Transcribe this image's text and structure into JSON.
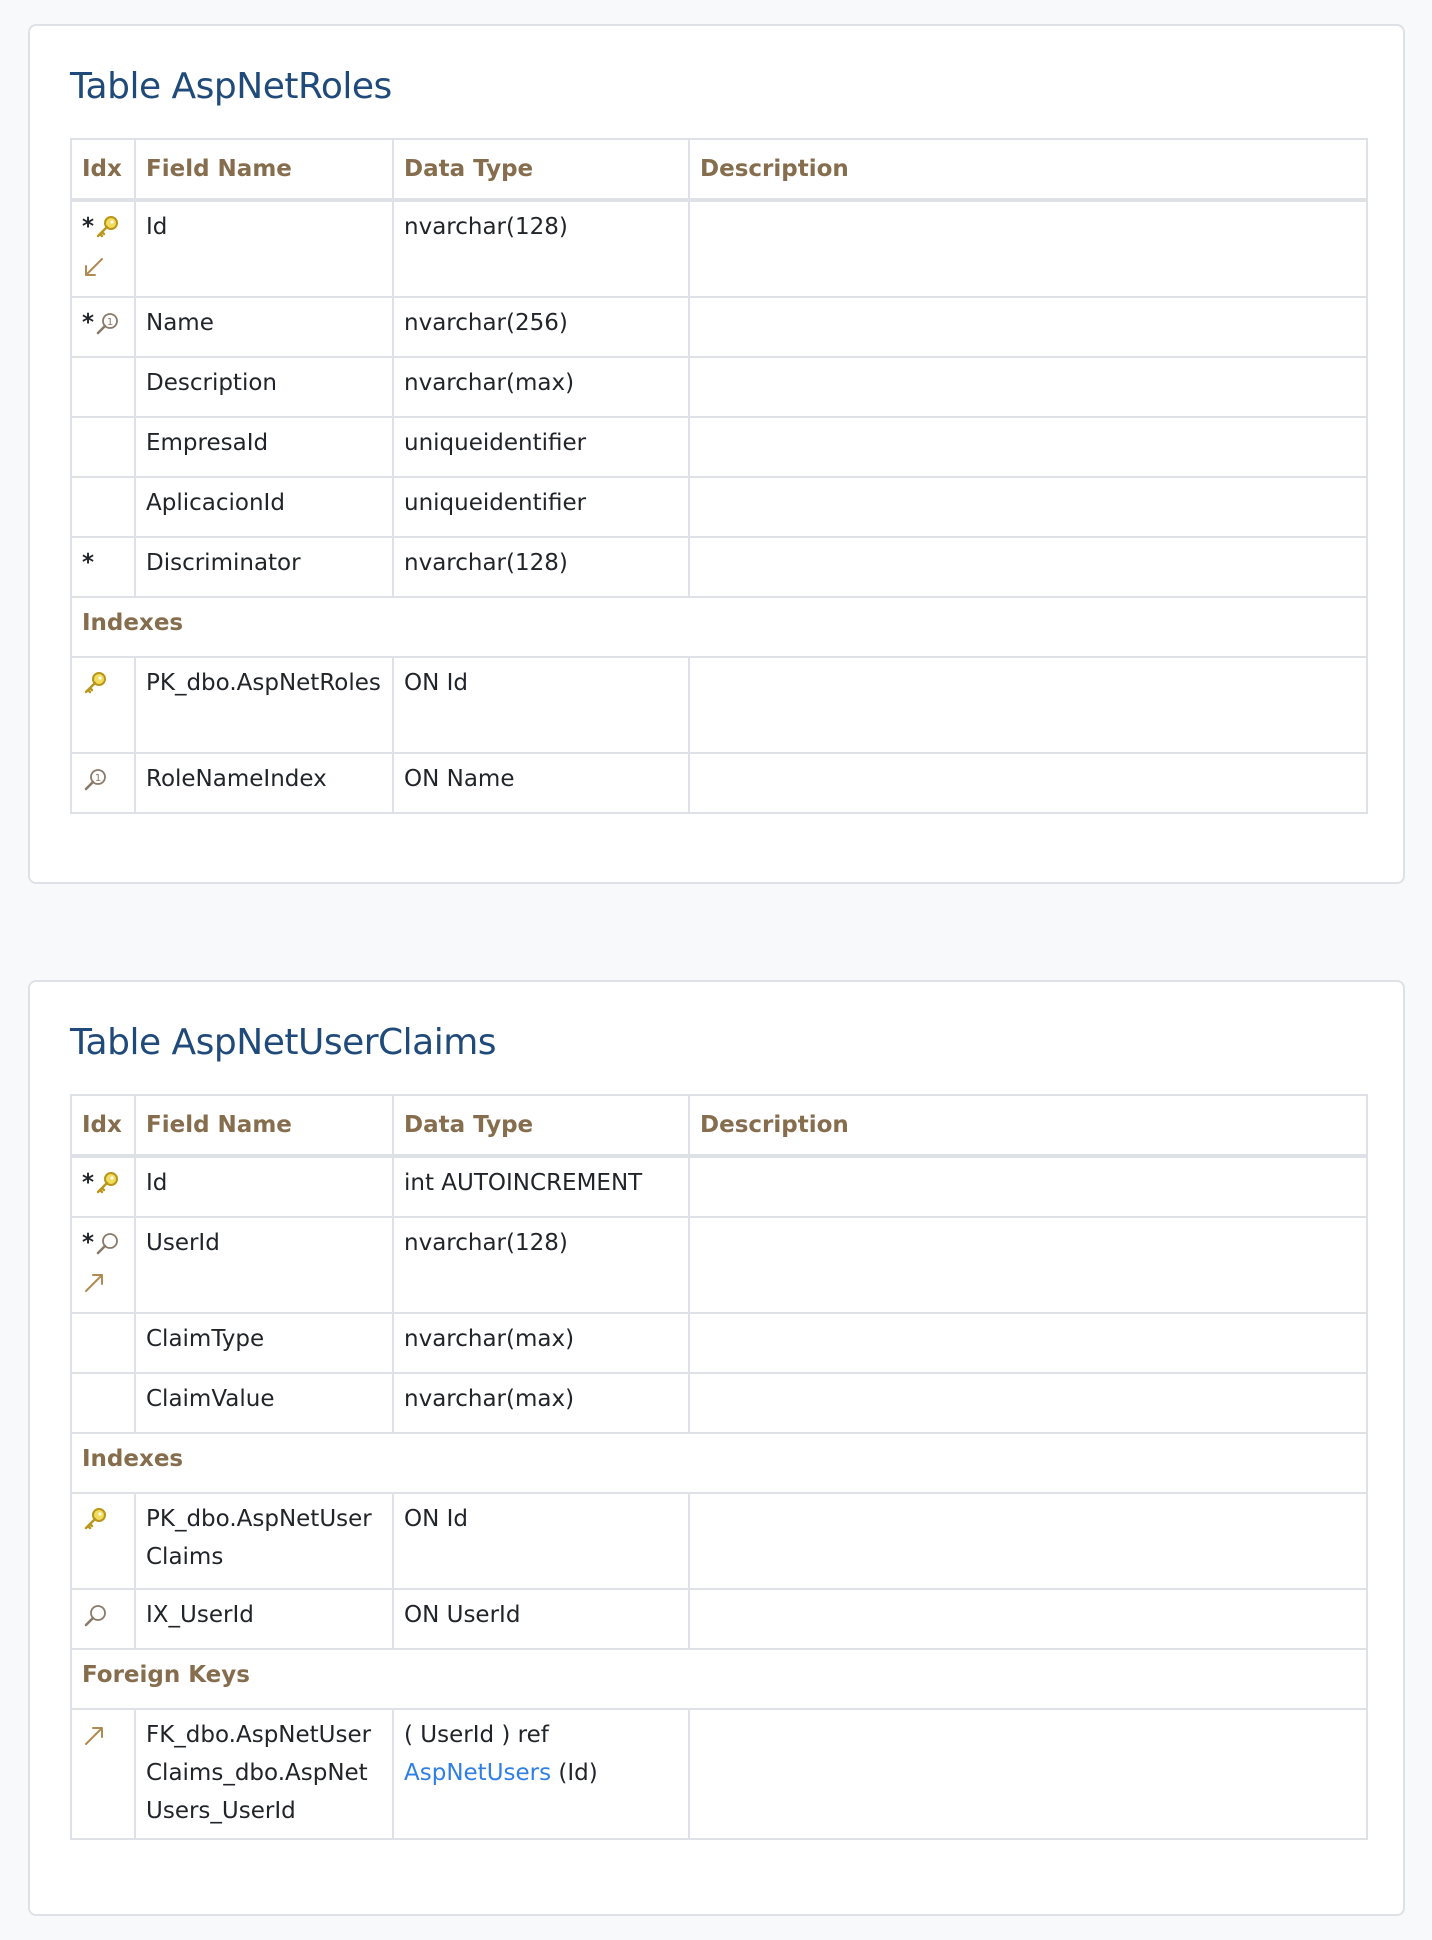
{
  "tables": [
    {
      "title": "Table AspNetRoles",
      "headers": {
        "idx": "Idx",
        "field": "Field Name",
        "type": "Data Type",
        "desc": "Description"
      },
      "columns": [
        {
          "star": "*",
          "icons": [
            "pk-key-icon",
            "fk-in-arrow-icon"
          ],
          "name": "Id",
          "type": "nvarchar(128)",
          "desc": ""
        },
        {
          "star": "*",
          "icons": [
            "unique-index-icon"
          ],
          "name": "Name",
          "type": "nvarchar(256)",
          "desc": ""
        },
        {
          "star": "",
          "icons": [],
          "name": "Description",
          "type": "nvarchar(max)",
          "desc": ""
        },
        {
          "star": "",
          "icons": [],
          "name": "EmpresaId",
          "type": "uniqueidentifier",
          "desc": ""
        },
        {
          "star": "",
          "icons": [],
          "name": "AplicacionId",
          "type": "uniqueidentifier",
          "desc": ""
        },
        {
          "star": "*",
          "icons": [],
          "name": "Discriminator",
          "type": "nvarchar(128)",
          "desc": ""
        }
      ],
      "indexes_label": "Indexes",
      "indexes": [
        {
          "icon": "pk-key-icon",
          "name": "PK_dbo.AspNetRoles",
          "on": "ON Id",
          "desc": ""
        },
        {
          "icon": "unique-index-icon",
          "name": "RoleNameIndex",
          "on": "ON Name",
          "desc": ""
        }
      ]
    },
    {
      "title": "Table AspNetUserClaims",
      "headers": {
        "idx": "Idx",
        "field": "Field Name",
        "type": "Data Type",
        "desc": "Description"
      },
      "columns": [
        {
          "star": "*",
          "icons": [
            "pk-key-icon"
          ],
          "name": "Id",
          "type": "int AUTOINCREMENT",
          "desc": ""
        },
        {
          "star": "*",
          "icons": [
            "index-icon",
            "fk-out-arrow-icon"
          ],
          "name": "UserId",
          "type": "nvarchar(128)",
          "desc": ""
        },
        {
          "star": "",
          "icons": [],
          "name": "ClaimType",
          "type": "nvarchar(max)",
          "desc": ""
        },
        {
          "star": "",
          "icons": [],
          "name": "ClaimValue",
          "type": "nvarchar(max)",
          "desc": ""
        }
      ],
      "indexes_label": "Indexes",
      "indexes": [
        {
          "icon": "pk-key-icon",
          "name": "PK_dbo.AspNetUserClaims",
          "on": "ON Id",
          "desc": ""
        },
        {
          "icon": "index-icon",
          "name": "IX_UserId",
          "on": "ON UserId",
          "desc": ""
        }
      ],
      "fk_label": "Foreign Keys",
      "foreign_keys": [
        {
          "icon": "fk-out-arrow-icon",
          "name": "FK_dbo.AspNetUserClaims_dbo.AspNetUsers_UserId",
          "ref_prefix": "( UserId ) ref",
          "ref_table": "AspNetUsers",
          "ref_suffix": " (Id)",
          "desc": ""
        }
      ]
    }
  ],
  "colors": {
    "title": "#1f4a7a",
    "header": "#856d4d",
    "link": "#2f7fe6",
    "border": "#dee2e6",
    "key": "#e0c020"
  }
}
